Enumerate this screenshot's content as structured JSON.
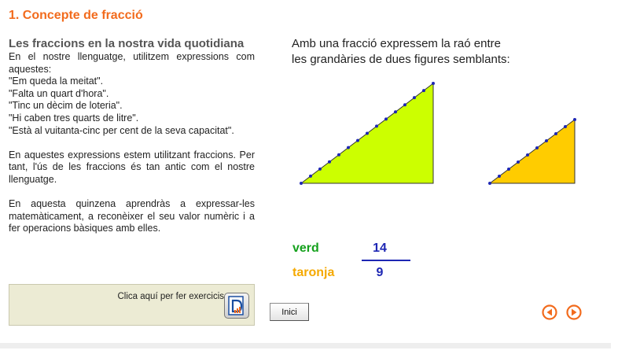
{
  "page": {
    "title": "1. Concepte de fracció"
  },
  "left": {
    "subtitle": "Les fraccions en la nostra vida quotidiana",
    "paragraph1": [
      "En el nostre llenguatge, utilitzem expressions com aquestes:",
      "\"Em queda la meitat\".",
      "\"Falta un quart d'hora\".",
      "\"Tinc un dècim de loteria\".",
      "\"Hi caben tres quarts de litre\".",
      "\"Està al vuitanta-cinc per cent de la seva capacitat\"."
    ],
    "paragraph2": "En aquestes expressions estem utilitzant fraccions. Per tant, l'ús de les fraccions és tan antic com el nostre llenguatge.",
    "paragraph3": "En aquesta quinzena aprendràs a expressar-les matemàticament, a reconèixer el seu valor numèric i a fer operacions bàsiques amb elles."
  },
  "exercise": {
    "label": "Clica aquí per fer exercicis",
    "icon": "exercise-document-icon"
  },
  "figure": {
    "intro_line1": "Amb una fracció expressem la raó entre",
    "intro_line2": "les grandàries de dues figures semblants:",
    "big_triangle": {
      "color": "#ccff00",
      "points_on_hypotenuse": 14
    },
    "small_triangle": {
      "color": "#ffcc00",
      "points_on_hypotenuse": 9
    },
    "fraction": {
      "label_top": "verd",
      "label_bottom": "taronja",
      "numerator": "14",
      "denominator": "9",
      "label_top_color": "#15a11d",
      "label_bottom_color": "#f5a900",
      "number_color": "#1e27b4"
    }
  },
  "nav": {
    "home_label": "Inici",
    "prev_icon": "circle-arrow-left-icon",
    "next_icon": "circle-arrow-right-icon",
    "accent": "#f26b1d"
  }
}
